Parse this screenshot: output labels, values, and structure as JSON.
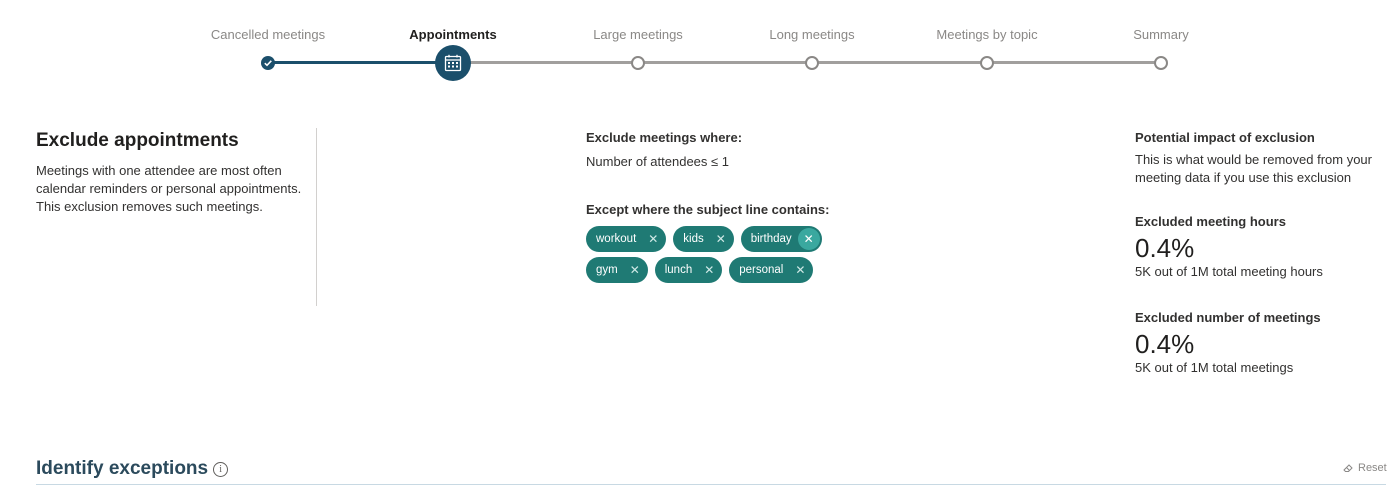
{
  "stepper": {
    "steps": [
      {
        "label": "Cancelled meetings",
        "state": "done"
      },
      {
        "label": "Appointments",
        "state": "current"
      },
      {
        "label": "Large meetings",
        "state": "pending"
      },
      {
        "label": "Long meetings",
        "state": "pending"
      },
      {
        "label": "Meetings by topic",
        "state": "pending"
      },
      {
        "label": "Summary",
        "state": "pending"
      }
    ],
    "current_icon": "calendar-icon",
    "done_icon": "checkmark-icon",
    "accent": "#1b4f6b"
  },
  "intro": {
    "title": "Exclude appointments",
    "description": "Meetings with one attendee are most often calendar reminders or personal appointments. This exclusion removes such meetings."
  },
  "rules": {
    "exclude_heading": "Exclude meetings where:",
    "exclude_condition": "Number of attendees ≤ 1",
    "except_heading": "Except where the subject line contains:",
    "keywords": [
      "workout",
      "kids",
      "birthday",
      "gym",
      "lunch",
      "personal"
    ],
    "chip_color": "#1f7a74"
  },
  "impact": {
    "title": "Potential impact of exclusion",
    "description": "This is what would be removed from your meeting data if you use this exclusion",
    "hours_label": "Excluded meeting hours",
    "hours_value": "0.4%",
    "hours_detail": "5K out of 1M total meeting hours",
    "meetings_label": "Excluded number of meetings",
    "meetings_value": "0.4%",
    "meetings_detail": "5K out of 1M total meetings"
  },
  "footer": {
    "section_title": "Identify exceptions",
    "reset_label": "Reset"
  }
}
